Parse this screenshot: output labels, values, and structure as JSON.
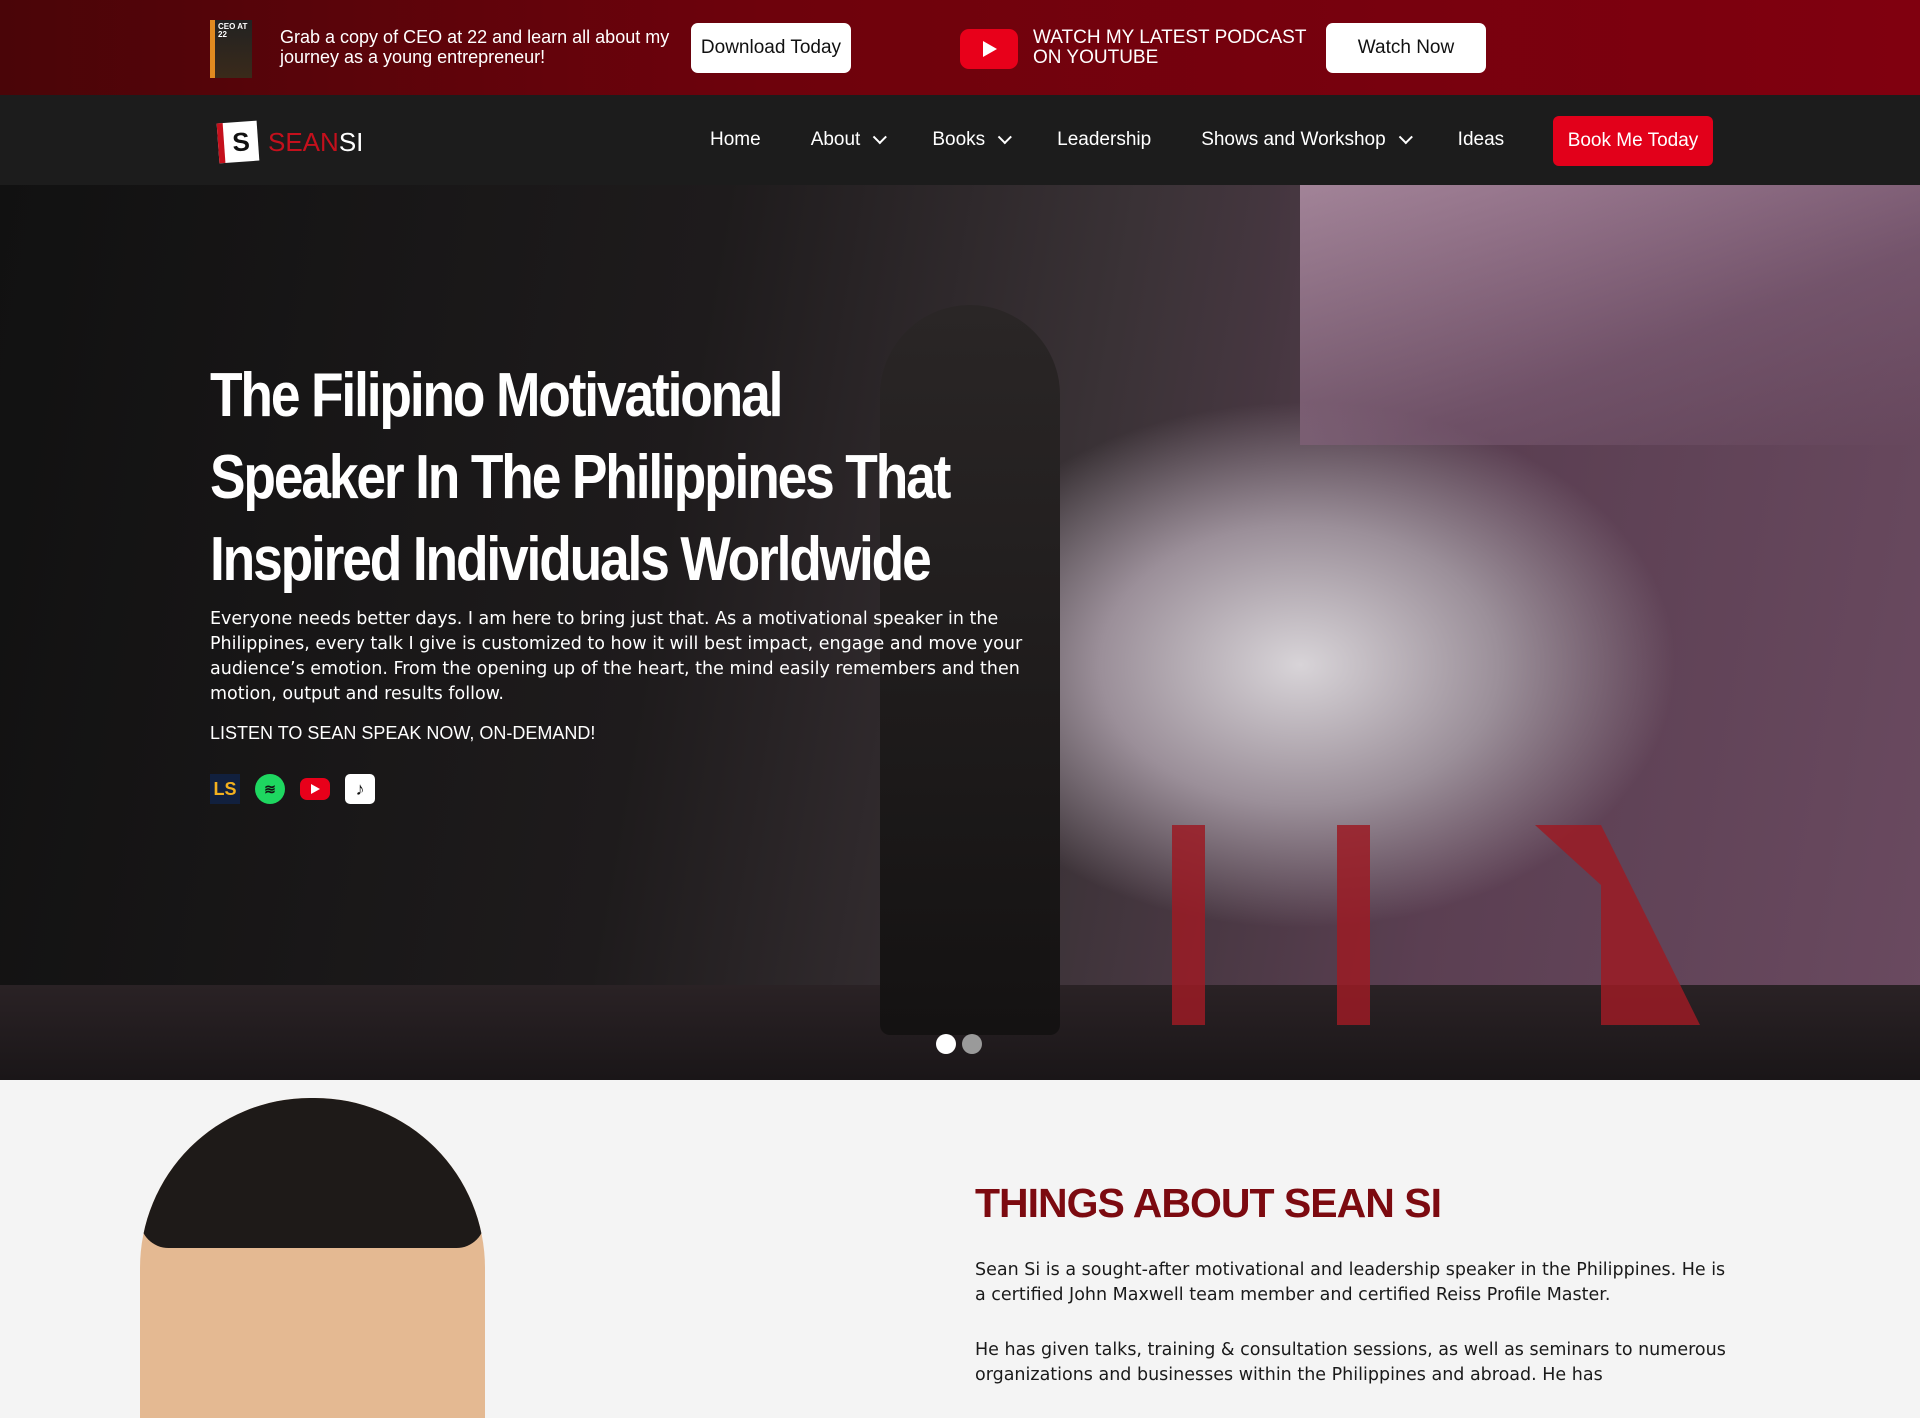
{
  "topbar": {
    "book_cover_text": "CEO AT 22",
    "promo_text": "Grab a copy of CEO at 22 and learn all about my journey as a young entrepreneur!",
    "download_label": "Download Today",
    "podcast_text": "WATCH MY LATEST PODCAST ON YOUTUBE",
    "watch_label": "Watch Now"
  },
  "nav": {
    "logo_red": "SEAN",
    "logo_white": "SI",
    "logo_mark": "S",
    "items": [
      {
        "label": "Home"
      },
      {
        "label": "About"
      },
      {
        "label": "Books"
      },
      {
        "label": "Leadership"
      },
      {
        "label": "Shows and Workshop"
      },
      {
        "label": "Ideas"
      }
    ],
    "cta": "Book Me Today"
  },
  "hero": {
    "title": "The Filipino Motivational Speaker In The Philippines That Inspired Individuals Worldwide",
    "body": "Everyone needs better days. I am here to bring just that. As a motivational speaker in the Philippines, every talk I give is customized to how it will best impact, engage and move your audience’s emotion. From the opening up of the heart, the mind easily remembers and then motion, output and results follow.",
    "listen": "LISTEN TO SEAN SPEAK NOW, ON-DEMAND!",
    "platforms": [
      "ls-icon",
      "spotify-icon",
      "youtube-icon",
      "tiktok-icon"
    ],
    "slide_count": 2,
    "active_slide": 1
  },
  "about": {
    "heading": "THINGS ABOUT SEAN SI",
    "p1": "Sean Si is a sought-after motivational and leadership speaker in the Philippines. He is a certified John Maxwell team member and certified Reiss Profile Master.",
    "p2": "He has given talks, training & consultation sessions, as well as seminars to numerous organizations and businesses within the Philippines and abroad. He has"
  },
  "colors": {
    "brand_red": "#e2001a",
    "heading_red": "#7c0a10"
  }
}
